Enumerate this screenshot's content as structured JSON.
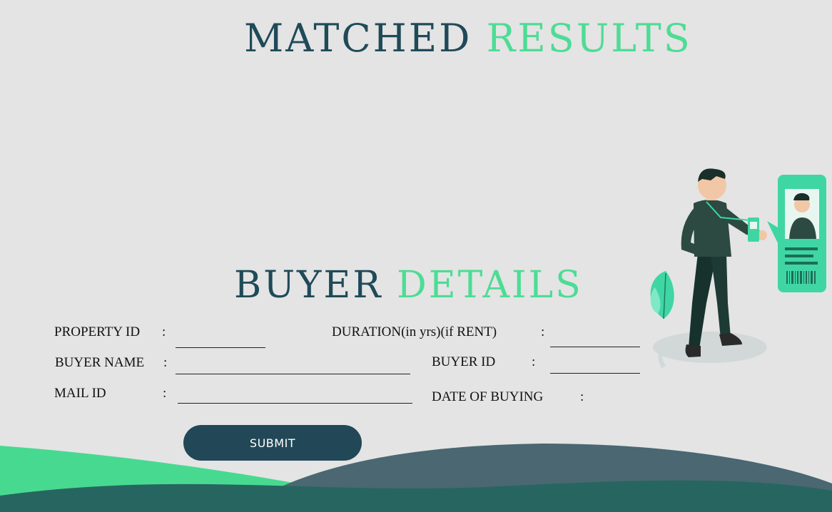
{
  "header": {
    "title_dark": "MATCHED",
    "title_green": "RESULTS"
  },
  "form": {
    "title_dark": "BUYER",
    "title_green": "DETAILS",
    "colon": ":",
    "fields": {
      "property_id": {
        "label": "PROPERTY ID",
        "value": ""
      },
      "duration": {
        "label": "DURATION(in yrs)(if RENT)",
        "value": ""
      },
      "buyer_name": {
        "label": "BUYER NAME",
        "value": ""
      },
      "buyer_id": {
        "label": "BUYER ID",
        "value": ""
      },
      "mail_id": {
        "label": "MAIL ID",
        "value": ""
      },
      "date_of_buying": {
        "label": "DATE OF BUYING"
      }
    },
    "submit_label": "SUBMIT"
  },
  "colors": {
    "dark_teal": "#1f4a58",
    "accent_green": "#4ddc95",
    "background": "#e4e4e4",
    "button": "#224857"
  },
  "illustration": {
    "icon": "person-holding-id-card-icon"
  }
}
